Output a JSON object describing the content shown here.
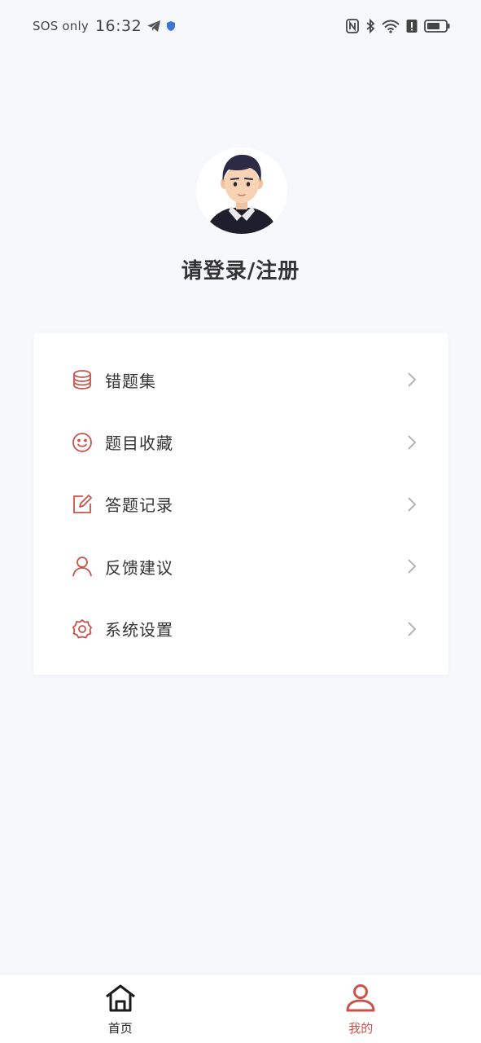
{
  "status_bar": {
    "carrier": "SOS only",
    "time": "16:32",
    "icons": [
      "telegram-icon",
      "shield-icon",
      "nfc-icon",
      "bluetooth-icon",
      "wifi-icon",
      "alert-icon",
      "battery-icon"
    ]
  },
  "profile": {
    "avatar": "avatar",
    "login_prompt": "请登录/注册"
  },
  "menu": {
    "items": [
      {
        "label": "错题集",
        "icon": "database-icon"
      },
      {
        "label": "题目收藏",
        "icon": "smile-icon"
      },
      {
        "label": "答题记录",
        "icon": "edit-icon"
      },
      {
        "label": "反馈建议",
        "icon": "user-icon"
      },
      {
        "label": "系统设置",
        "icon": "gear-icon"
      }
    ]
  },
  "bottom_nav": {
    "items": [
      {
        "label": "首页",
        "icon": "home-icon",
        "active": false
      },
      {
        "label": "我的",
        "icon": "profile-icon",
        "active": true
      }
    ]
  },
  "colors": {
    "accent": "#c9524a",
    "background": "#f7f8fb",
    "card": "#ffffff",
    "text": "#333333",
    "chevron": "#b3b3b3"
  }
}
